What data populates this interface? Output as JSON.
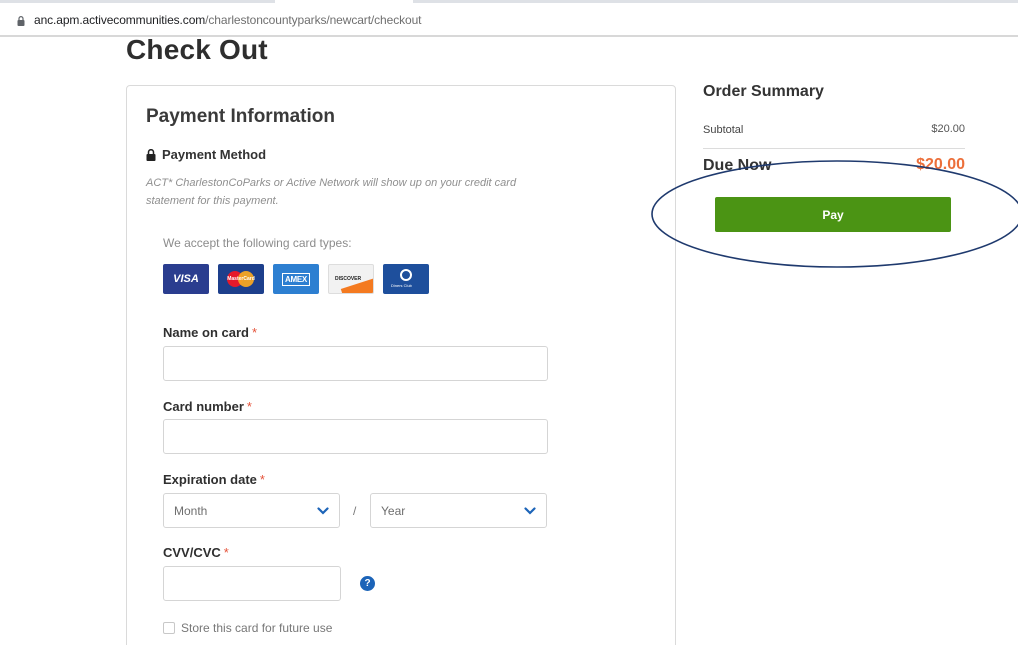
{
  "browser": {
    "url_host": "anc.apm.activecommunities.com",
    "url_path": "/charlestoncountyparks/newcart/checkout"
  },
  "page": {
    "title": "Check Out"
  },
  "payment": {
    "title": "Payment Information",
    "method_label": "Payment Method",
    "statement_note": "ACT* CharlestonCoParks or Active Network will show up on your credit card statement for this payment.",
    "accept_label": "We accept the following card types:",
    "cards": {
      "visa": "VISA",
      "mastercard": "MasterCard",
      "amex": "AMEX",
      "discover": "DISCOVER",
      "diners": "Diners Club"
    },
    "name_label": "Name on card",
    "card_number_label": "Card number",
    "expiration_label": "Expiration date",
    "month_placeholder": "Month",
    "year_placeholder": "Year",
    "slash": "/",
    "cvv_label": "CVV/CVC",
    "required_mark": "*",
    "help_icon": "?",
    "store_card_label": "Store this card for future use"
  },
  "summary": {
    "title": "Order Summary",
    "subtotal_label": "Subtotal",
    "subtotal_value": "$20.00",
    "due_label": "Due Now",
    "due_value": "$20.00",
    "pay_label": "Pay",
    "accent_color": "#ec6f3a",
    "pay_color": "#4b9414"
  }
}
